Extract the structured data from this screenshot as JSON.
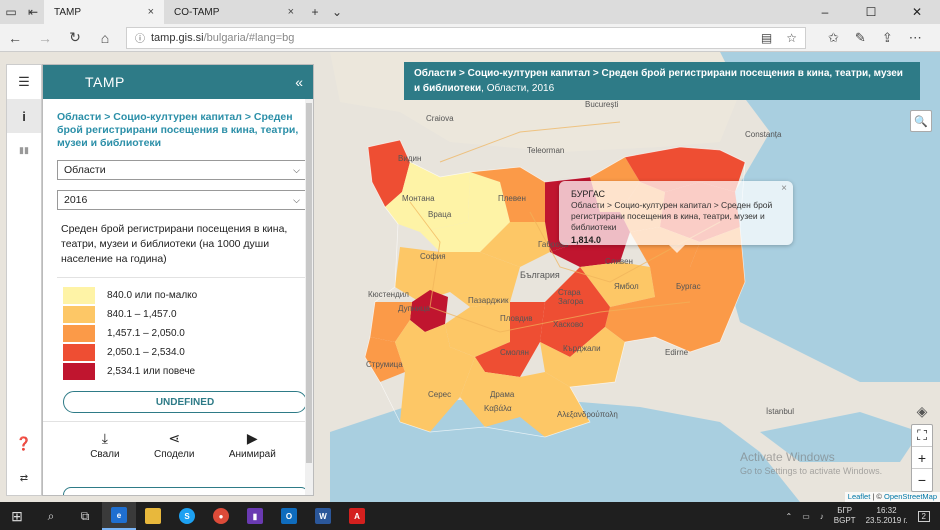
{
  "browser": {
    "tabs": [
      {
        "label": "TAMP",
        "active": true
      },
      {
        "label": "CO-TAMP",
        "active": false
      }
    ],
    "url_host": "tamp.gis.si",
    "url_path": "/bulgaria/#lang=bg"
  },
  "panel": {
    "title": "TAMP",
    "collapse_glyph": "«",
    "breadcrumb": "Области > Социо-културен капитал > Среден брой регистрирани посещения в кина, театри, музеи и библиотеки",
    "level_select": "Области",
    "year_select": "2016",
    "description": "Среден брой регистрирани посещения в кина, театри, музеи и библиотеки (на 1000 души население на година)",
    "legend": [
      {
        "label": "840.0 или по-малко",
        "color": "#fef3a6"
      },
      {
        "label": "840.1 – 1,457.0",
        "color": "#fdc766"
      },
      {
        "label": "1,457.1 – 2,050.0",
        "color": "#fb9a48"
      },
      {
        "label": "2,050.1 – 2,534.0",
        "color": "#ee4e33"
      },
      {
        "label": "2,534.1 или повече",
        "color": "#c0152f"
      }
    ],
    "undefined_label": "UNDEFINED",
    "actions": {
      "save": "Свали",
      "share": "Сподели",
      "animate": "Анимирай"
    }
  },
  "map_title": {
    "path": "Области > Социо-културен капитал > Среден брой регистрирани посещения в кина, театри, музеи и библиотеки",
    "suffix": ", Области, 2016"
  },
  "popup": {
    "region": "БУРГАС",
    "subtitle": "Области > Социо-културен капитал > Среден брой регистрирани посещения в кина, театри, музеи и библиотеки",
    "value": "1,814.0",
    "close": "×"
  },
  "map_labels": {
    "craiova": "Craiova",
    "bucuresti": "București",
    "teleorman": "Teleorman",
    "vidin": "Видин",
    "montana": "Монтана",
    "vratsa": "Враца",
    "pleven": "Плевен",
    "gabrovo": "Габрово",
    "sofia": "София",
    "bulgaria": "България",
    "sliven": "Сливен",
    "kyustendil": "Кюстендил",
    "pazardzhik": "Пазарджик",
    "plovdiv": "Пловдив",
    "stara_zagora": "Стара Загора",
    "yambol": "Ямбол",
    "burgas": "Бургас",
    "dupnitsa": "Дупница",
    "haskovo": "Хасково",
    "smolyan": "Смолян",
    "kardzhali": "Кърджали",
    "strumitsa": "Струмица",
    "serres": "Серес",
    "drama": "Драма",
    "kavala": "Καβάλα",
    "alexandroupoli": "Αλεξανδρούπολη",
    "istanbul": "İstanbul",
    "edirne": "Edirne",
    "constanta": "Constanța"
  },
  "attribution": {
    "leaflet": "Leaflet",
    "sep": " | © ",
    "osm": "OpenStreetMap"
  },
  "watermark": {
    "line1": "Activate Windows",
    "line2": "Go to Settings to activate Windows."
  },
  "taskbar": {
    "lang1": "БГР",
    "lang2": "BGPT",
    "time": "16:32",
    "date": "23.5.2019 г.",
    "notifications": "2"
  },
  "colors": {
    "accent": "#2e7b87",
    "link": "#2b8fa8"
  }
}
